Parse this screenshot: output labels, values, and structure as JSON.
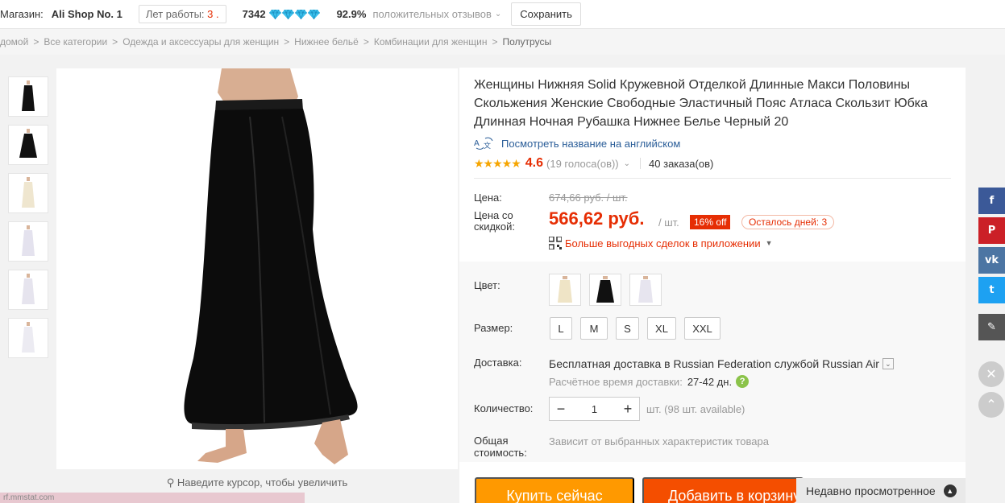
{
  "store": {
    "label": "Магазин:",
    "name": "Ali Shop No. 1",
    "years_label": "Лет работы:",
    "years_value": "3 .",
    "score": "7342",
    "positive_pct": "92.9%",
    "positive_label": "положительных отзывов",
    "save_label": "Сохранить"
  },
  "breadcrumb": [
    "домой",
    "Все категории",
    "Одежда и аксессуары для женщин",
    "Нижнее бельё",
    "Комбинации для женщин",
    "Полутрусы"
  ],
  "thumbnails": [
    {
      "color": "#111111"
    },
    {
      "color": "#111111"
    },
    {
      "color": "#efe6cf"
    },
    {
      "color": "#e4e2ee"
    },
    {
      "color": "#e6e4ee"
    },
    {
      "color": "#ecebf2"
    }
  ],
  "zoom_hint": "Наведите курсор, чтобы увеличить",
  "bottom_strip_text": "rf.mmstat.com",
  "product": {
    "title": "Женщины Нижняя Solid Кружевной Отделкой Длинные Макси Половины Скольжения Женские Свободные Эластичный Пояс Атласа Скользит Юбка Длинная Ночная Рубашка Нижнее Белье Черный 20",
    "translate_icon": "translate-icon",
    "translate_text": "Посмотреть название на английском",
    "stars": "★★★★★",
    "rating": "4.6",
    "votes": "(19 голоса(ов))",
    "orders": "40 заказа(ов)"
  },
  "pricing": {
    "price_label": "Цена:",
    "old_price": "674,66 руб. / шт.",
    "discount_label": "Цена со скидкой:",
    "new_price": "566,62 руб.",
    "per_unit": "/ шт.",
    "off_badge": "16% off",
    "days_left": "Осталось дней: 3",
    "app_deals": "Больше выгодных сделок в приложении"
  },
  "options": {
    "color_label": "Цвет:",
    "colors": [
      {
        "name": "beige",
        "hex": "#efe4c6"
      },
      {
        "name": "black",
        "hex": "#111111"
      },
      {
        "name": "white",
        "hex": "#e7e5ef"
      }
    ],
    "size_label": "Размер:",
    "sizes": [
      "L",
      "M",
      "S",
      "XL",
      "XXL"
    ],
    "shipping_label": "Доставка:",
    "shipping_free": "Бесплатная доставка в",
    "shipping_dest": "Russian Federation службой Russian Air",
    "shipping_time_label": "Расчётное время доставки:",
    "shipping_time_value": "27-42 дн.",
    "qty_label": "Количество:",
    "qty_value": "1",
    "qty_available": "шт. (98 шт. available)",
    "total_label": "Общая стоимость:",
    "total_value": "Зависит от выбранных характеристик товара"
  },
  "buttons": {
    "buy_now": "Купить сейчас",
    "add_to_cart": "Добавить в корзину"
  },
  "recently_viewed": "Недавно просмотренное",
  "social": [
    {
      "name": "facebook",
      "glyph": "f",
      "color": "#3b5998"
    },
    {
      "name": "pinterest",
      "glyph": "P",
      "color": "#cb2027"
    },
    {
      "name": "vk",
      "glyph": "vk",
      "color": "#4c75a3"
    },
    {
      "name": "twitter",
      "glyph": "t",
      "color": "#1da1f2"
    },
    {
      "name": "edit",
      "glyph": "✎",
      "color": "#555555"
    }
  ],
  "colors": {
    "accent_red": "#e62e04",
    "buy_orange": "#ff9900",
    "cart_orange": "#f44e00",
    "link_blue": "#2a5d98"
  }
}
